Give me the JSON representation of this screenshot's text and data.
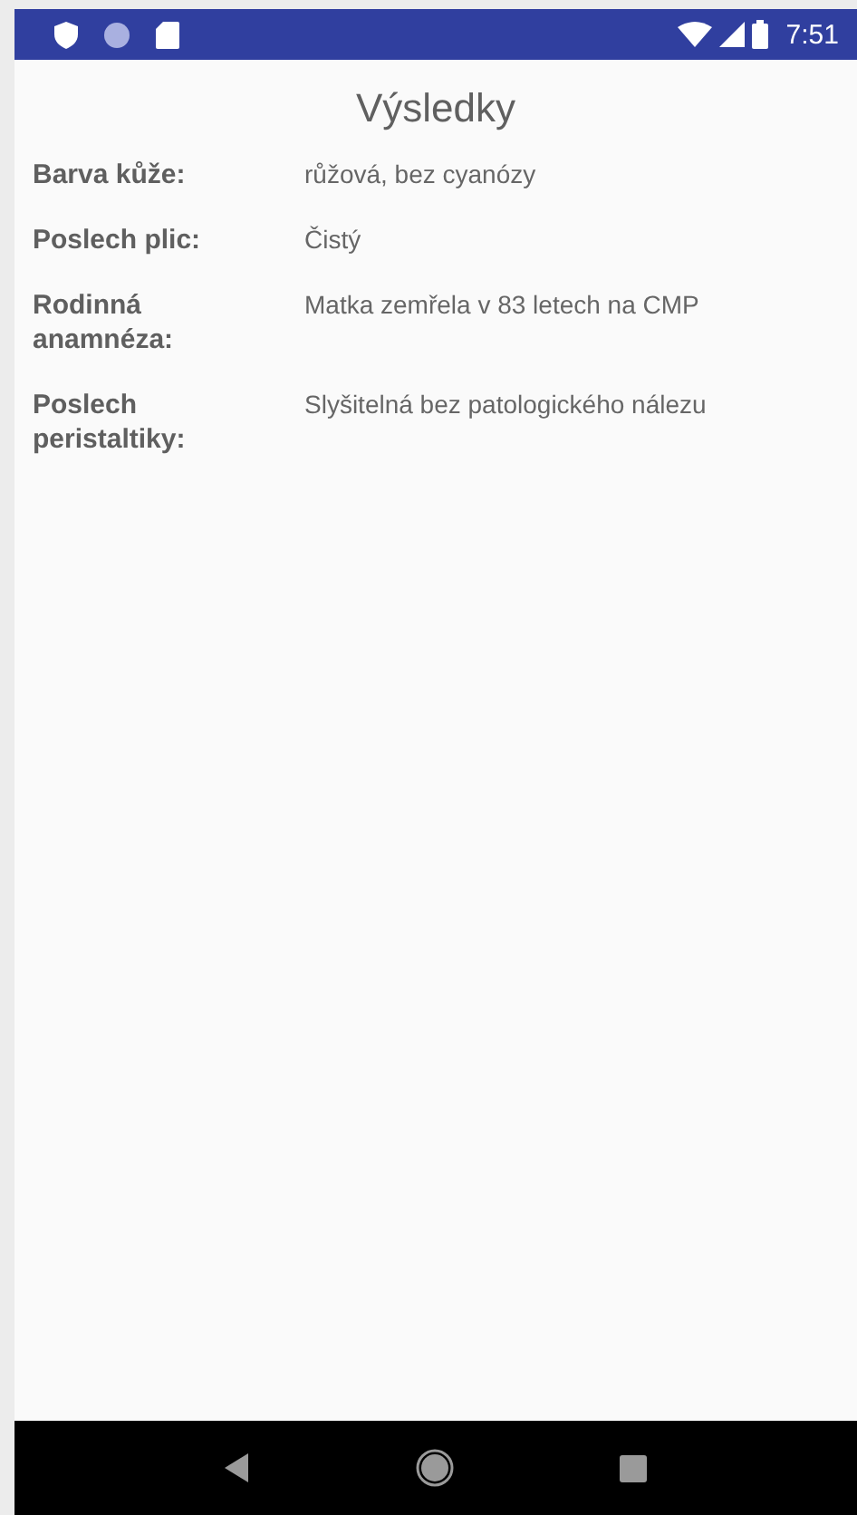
{
  "status_bar": {
    "time": "7:51"
  },
  "title": "Výsledky",
  "results": [
    {
      "label": "Barva kůže:",
      "value": "růžová, bez cyanózy"
    },
    {
      "label": "Poslech plic:",
      "value": "Čistý"
    },
    {
      "label": "Rodinná anamnéza:",
      "value": "Matka zemřela v 83 letech na CMP"
    },
    {
      "label": "Poslech peristaltiky:",
      "value": "Slyšitelná bez patologického nálezu"
    }
  ]
}
